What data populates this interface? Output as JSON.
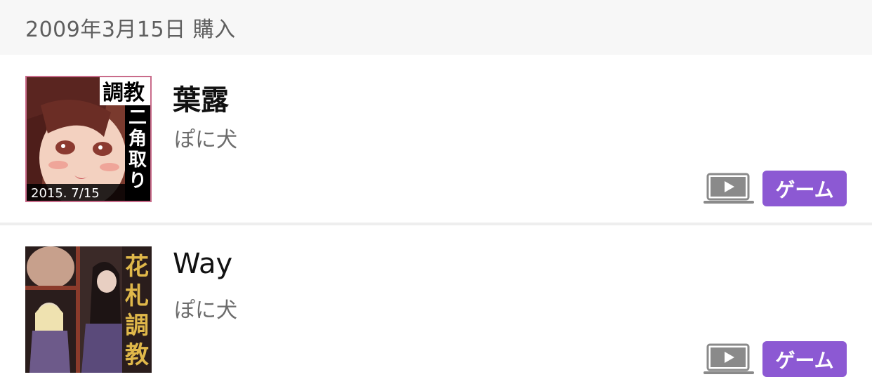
{
  "purchase_group": {
    "date_label": "2009年3月15日 購入"
  },
  "items": [
    {
      "title": "葉露",
      "circle": "ぽに犬",
      "platform_icon": "laptop-play-icon",
      "tag": "ゲーム",
      "thumbnail": {
        "text_vertical": [
          "調教",
          "二",
          "角",
          "取",
          "り"
        ],
        "date_stamp": "2015. 7/15"
      }
    },
    {
      "title": "Way",
      "circle": "ぽに犬",
      "platform_icon": "laptop-play-icon",
      "tag": "ゲーム",
      "thumbnail": {
        "text_vertical": [
          "花",
          "札",
          "調",
          "教"
        ]
      }
    }
  ],
  "colors": {
    "header_bg": "#f7f7f7",
    "tag_bg": "#8c59d3",
    "tag_text": "#ffffff",
    "title_text": "#111111",
    "circle_text": "#6c6c6c"
  }
}
